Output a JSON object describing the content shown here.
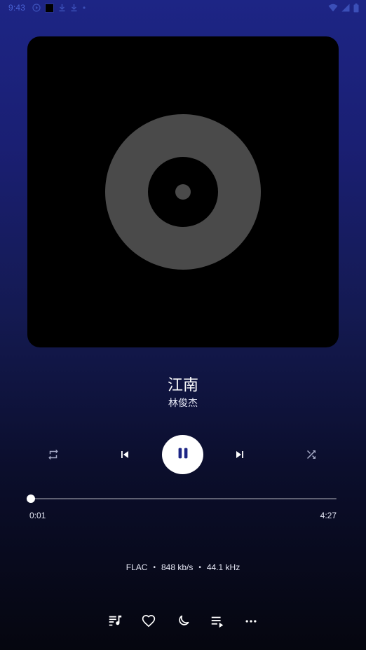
{
  "status_bar": {
    "time": "9:43"
  },
  "song": {
    "title": "江南",
    "artist": "林俊杰"
  },
  "playback": {
    "state": "playing",
    "elapsed": "0:01",
    "duration": "4:27",
    "progress_fraction": 0.004
  },
  "audio_format": {
    "codec": "FLAC",
    "bitrate": "848 kb/s",
    "sample_rate": "44.1 kHz",
    "separator": "•"
  },
  "icons": {
    "status_left": [
      "media-play-icon",
      "black-square-icon",
      "download-icon",
      "download-icon",
      "dot-icon"
    ],
    "status_right": [
      "wifi-icon",
      "signal-icon",
      "battery-icon"
    ],
    "controls": [
      "repeat-icon",
      "skip-previous-icon",
      "pause-icon",
      "skip-next-icon",
      "shuffle-icon"
    ],
    "actions": [
      "lyrics-icon",
      "heart-icon",
      "sleep-timer-moon-icon",
      "queue-icon",
      "more-icon"
    ]
  },
  "colors": {
    "accent": "#1d2585",
    "art_placeholder_disc": "#4a4a4a",
    "art_background": "#000000"
  }
}
